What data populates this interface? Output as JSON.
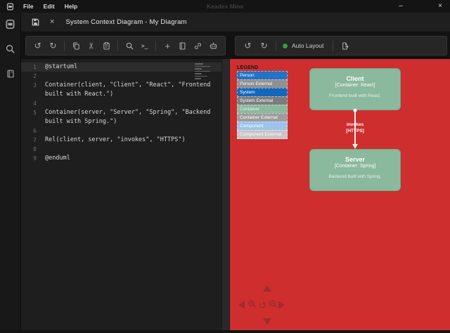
{
  "titlebar": {
    "menus": [
      "File",
      "Edit",
      "Help"
    ],
    "app_title": "Keadex Mina",
    "window_controls": {
      "minimize": "–",
      "close": "×"
    }
  },
  "tabbar": {
    "title": "System Context Diagram - My Diagram",
    "close_glyph": "×"
  },
  "activitybar": {
    "items": [
      "mina-projects",
      "search",
      "library"
    ]
  },
  "editor_toolbar": {
    "icons": [
      "undo",
      "redo",
      "copy",
      "cut",
      "paste",
      "search",
      "terminal",
      "add",
      "library",
      "link",
      "ai-assistant"
    ],
    "undo_glyph": "↺",
    "redo_glyph": "↻",
    "cut_glyph": "✂",
    "terminal_glyph": ">_",
    "add_glyph": "+"
  },
  "diagram_toolbar": {
    "icons": [
      "undo",
      "redo",
      "auto-layout-toggle",
      "export"
    ],
    "undo_glyph": "↺",
    "redo_glyph": "↻",
    "auto_layout_label": "Auto Layout",
    "auto_layout_status_color": "#2ea043"
  },
  "editor": {
    "language": "plantuml",
    "rows": [
      {
        "num": "1",
        "text": "@startuml",
        "bg": "#2c2c2c"
      },
      {
        "num": "2",
        "text": ""
      },
      {
        "num": "3",
        "text": "Container(client, \"Client\", \"React\", \"Frontend"
      },
      {
        "num": "",
        "text": "built with React.\")"
      },
      {
        "num": "4",
        "text": ""
      },
      {
        "num": "5",
        "text": "Container(server, \"Server\", \"Spring\", \"Backend"
      },
      {
        "num": "",
        "text": "built with Spring.\")"
      },
      {
        "num": "6",
        "text": ""
      },
      {
        "num": "7",
        "text": "Rel(client, server, \"invokes\", \"HTTPS\")"
      },
      {
        "num": "8",
        "text": ""
      },
      {
        "num": "9",
        "text": "@enduml"
      }
    ]
  },
  "canvas": {
    "background_color": "#cf2e2e",
    "legend": {
      "title": "LEGEND",
      "items": [
        {
          "label": "Person",
          "bg": "#2571c4",
          "fg": "#ffffff"
        },
        {
          "label": "Person External",
          "bg": "#909090",
          "fg": "#ffffff"
        },
        {
          "label": "System",
          "bg": "#1168bd",
          "fg": "#ffffff"
        },
        {
          "label": "System External",
          "bg": "#7d7d7d",
          "fg": "#ffffff"
        },
        {
          "label": "Container",
          "bg": "#8ab99d",
          "fg": "#e9f2ec"
        },
        {
          "label": "Container External",
          "bg": "#9c9c9c",
          "fg": "#ffffff"
        },
        {
          "label": "Component",
          "bg": "#9dc3eb",
          "fg": "#ffffff"
        },
        {
          "label": "Component External",
          "bg": "#c6c6c6",
          "fg": "#ffffff"
        }
      ]
    },
    "nodes": [
      {
        "title": "Client",
        "subtitle": "[Container: React]",
        "description": "Frontend built with React.",
        "bg": "#8ab99d"
      },
      {
        "title": "Server",
        "subtitle": "[Container: Spring]",
        "description": "Backend built with Spring.",
        "bg": "#8ab99d"
      }
    ],
    "edge": {
      "label": "invokes",
      "tech": "[HTTPS]"
    },
    "nav": {
      "icons": [
        "pan-up",
        "pan-left",
        "zoom-in",
        "reset-zoom",
        "zoom-out",
        "pan-right",
        "pan-down"
      ],
      "reset_glyph": "↺"
    }
  }
}
